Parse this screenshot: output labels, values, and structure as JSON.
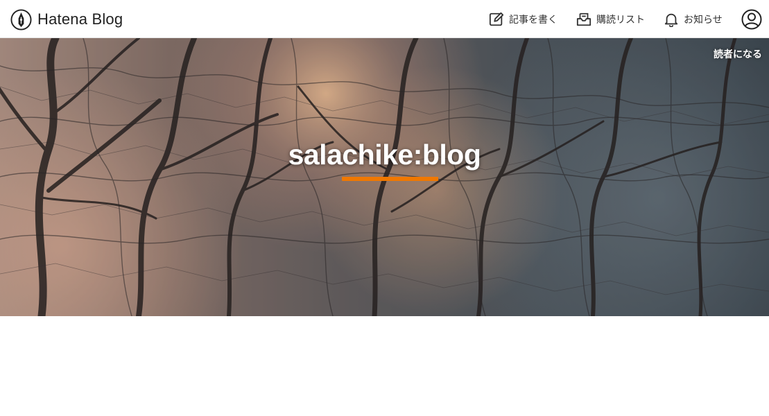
{
  "header": {
    "brand": {
      "name": "Hatena Blog",
      "icon": "hatena-pen-icon"
    },
    "nav": {
      "write": {
        "label": "記事を書く",
        "icon": "edit-icon"
      },
      "subscriptions": {
        "label": "購読リスト",
        "icon": "inbox-icon"
      },
      "notifications": {
        "label": "お知らせ",
        "icon": "bell-icon"
      },
      "user": {
        "icon": "user-icon"
      }
    }
  },
  "hero": {
    "subscribe_label": "読者になる",
    "blog_title": "salachike:blog",
    "background": "bare-trees-in-fog-photo",
    "accent_color": "#f07800"
  }
}
